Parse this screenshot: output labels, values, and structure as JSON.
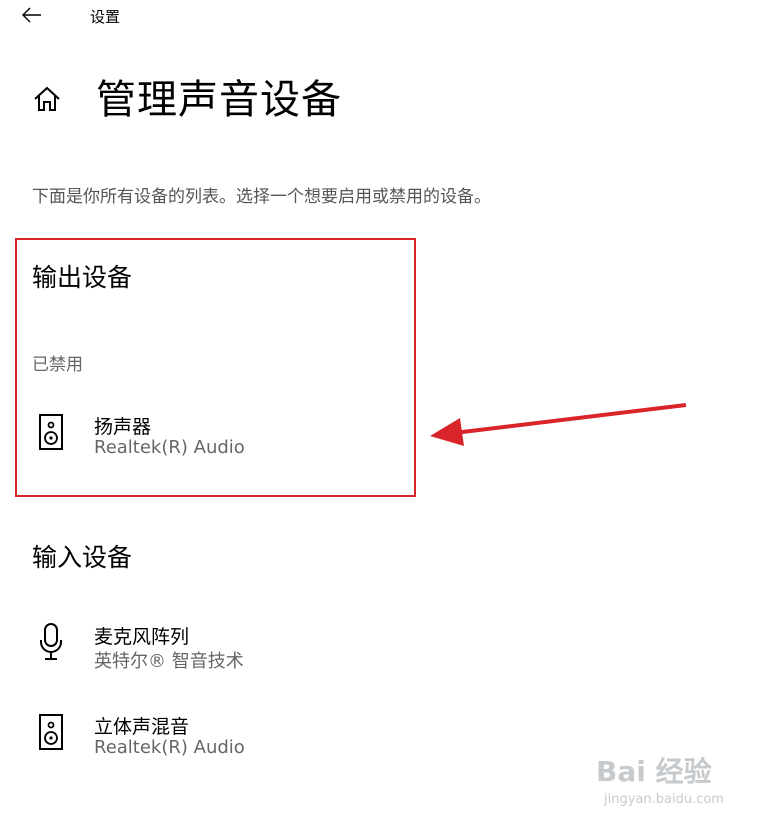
{
  "window": {
    "title": "设置"
  },
  "page": {
    "title": "管理声音设备",
    "description": "下面是你所有设备的列表。选择一个想要启用或禁用的设备。"
  },
  "output_section": {
    "title": "输出设备",
    "status": "已禁用",
    "devices": [
      {
        "name": "扬声器",
        "sub": "Realtek(R) Audio",
        "icon": "speaker-icon"
      }
    ]
  },
  "input_section": {
    "title": "输入设备",
    "devices": [
      {
        "name": "麦克风阵列",
        "sub": "英特尔® 智音技术",
        "icon": "microphone-icon"
      },
      {
        "name": "立体声混音",
        "sub": "Realtek(R) Audio",
        "icon": "speaker-icon"
      }
    ]
  },
  "annotation": {
    "color": "#d9242a"
  },
  "watermark": {
    "main": "Bai 经验",
    "sub": "jingyan.baidu.com"
  }
}
